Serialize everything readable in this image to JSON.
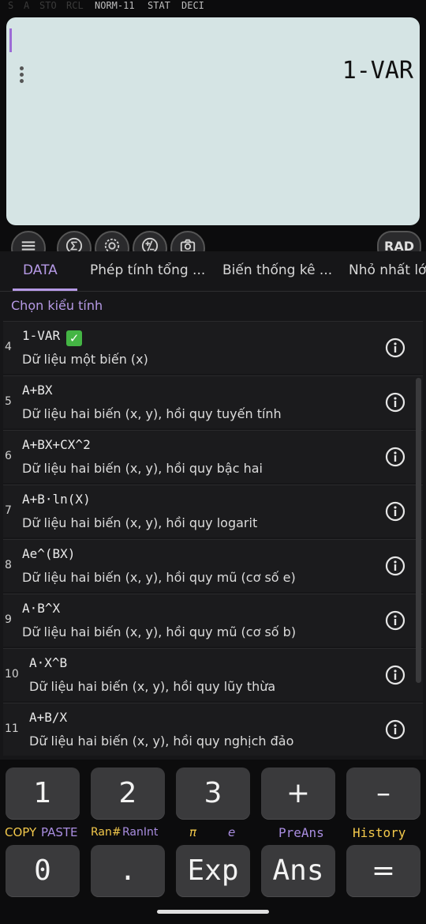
{
  "status_bar": {
    "items_dim": [
      "S",
      "A",
      "STO",
      "RCL"
    ],
    "items": [
      "NORM-11",
      "STAT",
      "DECI"
    ]
  },
  "display": {
    "text": "1-VAR"
  },
  "toolbar": {
    "icons": [
      "menu-icon",
      "sigma-icon",
      "settings-icon",
      "plus-minus-icon",
      "camera-icon"
    ],
    "angle_mode": "RAD"
  },
  "tabs": [
    "DATA",
    "Phép tính tổng ...",
    "Biến thống kê ...",
    "Nhỏ nhất lớ"
  ],
  "section_title": "Chọn kiểu tính",
  "modes": [
    {
      "num": "4",
      "title": "1-VAR",
      "checked": true,
      "desc": "Dữ liệu một biến (x)"
    },
    {
      "num": "5",
      "title": "A+BX",
      "desc": "Dữ liệu hai biến (x, y), hồi quy tuyến tính"
    },
    {
      "num": "6",
      "title": "A+BX+CX^2",
      "desc": "Dữ liệu hai biến (x, y), hồi quy bậc hai"
    },
    {
      "num": "7",
      "title": "A+B·ln(X)",
      "desc": "Dữ liệu hai biến (x, y), hồi quy logarit"
    },
    {
      "num": "8",
      "title": "Ae^(BX)",
      "desc": "Dữ liệu hai biến (x, y), hồi quy mũ (cơ số e)"
    },
    {
      "num": "9",
      "title": "A·B^X",
      "desc": "Dữ liệu hai biến (x, y), hồi quy mũ (cơ số b)"
    },
    {
      "num": "10",
      "title": "A·X^B",
      "desc": "Dữ liệu hai biến (x, y), hồi quy lũy thừa"
    },
    {
      "num": "11",
      "title": "A+B/X",
      "desc": "Dữ liệu hai biến (x, y), hồi quy nghịch đảo"
    }
  ],
  "keypad": {
    "row1": [
      "1",
      "2",
      "3",
      "+",
      "–"
    ],
    "secondary": {
      "copy": "COPY",
      "paste": "PASTE",
      "ran": "Ran#",
      "ranint": "RanInt",
      "pi": "π",
      "e": "e",
      "preans": "PreAns",
      "history": "History"
    },
    "row2": [
      "0",
      ".",
      "Exp",
      "Ans",
      "="
    ]
  },
  "colors": {
    "accent": "#b69ae6",
    "secondary_yellow": "#f2c84b",
    "secondary_purple": "#a98de0"
  }
}
